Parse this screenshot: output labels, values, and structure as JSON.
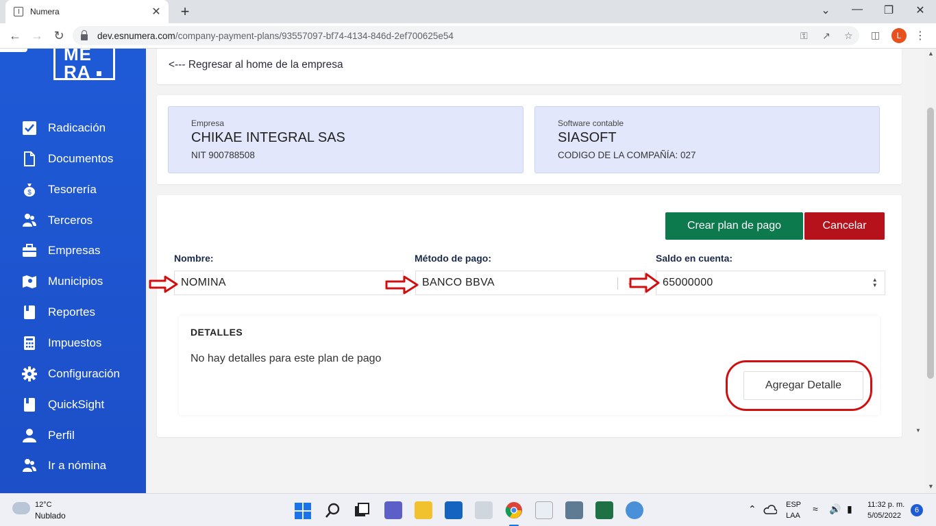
{
  "browser": {
    "tab_title": "Numera",
    "tab_close": "✕",
    "new_tab": "+",
    "url_domain": "dev.esnumera.com",
    "url_path": "/company-payment-plans/93557097-bf74-4134-846d-2ef700625e54",
    "profile_initial": "L",
    "window_controls": [
      "⌄",
      "—",
      "❐",
      "✕"
    ]
  },
  "sidebar": {
    "logo_line1": "ME",
    "logo_line2": "RA",
    "items": [
      {
        "label": "Radicación",
        "icon": "checkbox-icon"
      },
      {
        "label": "Documentos",
        "icon": "document-icon"
      },
      {
        "label": "Tesorería",
        "icon": "money-bag-icon"
      },
      {
        "label": "Terceros",
        "icon": "users-icon"
      },
      {
        "label": "Empresas",
        "icon": "briefcase-icon"
      },
      {
        "label": "Municipios",
        "icon": "map-icon"
      },
      {
        "label": "Reportes",
        "icon": "report-icon"
      },
      {
        "label": "Impuestos",
        "icon": "calculator-icon"
      },
      {
        "label": "Configuración",
        "icon": "gear-icon"
      },
      {
        "label": "QuickSight",
        "icon": "book-icon"
      },
      {
        "label": "Perfil",
        "icon": "user-icon"
      },
      {
        "label": "Ir a nómina",
        "icon": "users-icon"
      }
    ]
  },
  "header": {
    "back_link": "<--- Regresar al home de la empresa"
  },
  "company": {
    "label": "Empresa",
    "name": "CHIKAE INTEGRAL SAS",
    "nit": "NIT 900788508"
  },
  "software": {
    "label": "Software contable",
    "name": "SIASOFT",
    "code": "CODIGO DE LA COMPAÑÍA: 027"
  },
  "form": {
    "create_button": "Crear plan de pago",
    "cancel_button": "Cancelar",
    "name_label": "Nombre:",
    "name_value": "NOMINA",
    "method_label": "Método de pago:",
    "method_value": "BANCO BBVA",
    "balance_label": "Saldo en cuenta:",
    "balance_value": "65000000"
  },
  "details": {
    "title": "DETALLES",
    "empty_text": "No hay detalles para este plan de pago",
    "add_button": "Agregar Detalle"
  },
  "taskbar": {
    "temperature": "12°C",
    "weather": "Nublado",
    "language": "ESP",
    "layout": "LAA",
    "time": "11:32 p. m.",
    "date": "5/05/2022",
    "notifications": "6"
  },
  "colors": {
    "sidebar_blue": "#1f5ad6",
    "primary_green": "#0d7a4e",
    "cancel_red": "#b5121b",
    "annotation_red": "#d01010",
    "info_box_bg": "#e3e7fb"
  }
}
